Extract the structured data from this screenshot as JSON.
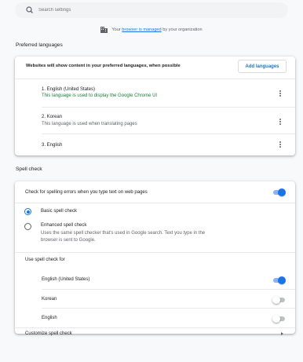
{
  "search": {
    "placeholder": "Search settings"
  },
  "managed": {
    "prefix": "Your",
    "link": "browser is managed",
    "suffix": "by your organization"
  },
  "languages": {
    "section_title": "Preferred languages",
    "header": "Websites will show content in your preferred languages, when possible",
    "add_button": "Add languages",
    "items": [
      {
        "name": "1. English (United States)",
        "note": "This language is used to display the Google Chrome UI"
      },
      {
        "name": "2. Korean",
        "note": "This language is used when translating pages"
      },
      {
        "name": "3. English",
        "note": ""
      }
    ]
  },
  "spell": {
    "section_title": "Spell check",
    "check_label": "Check for spelling errors when you type text on web pages",
    "check_enabled": true,
    "basic_label": "Basic spell check",
    "basic_selected": true,
    "enhanced_label": "Enhanced spell check",
    "enhanced_desc_1": "Uses the same spell checker that's used in Google search. Text you type in the",
    "enhanced_desc_2": "browser is sent to Google.",
    "enhanced_selected": false,
    "use_for_label": "Use spell check for",
    "use_for": [
      {
        "name": "English (United States)",
        "enabled": true
      },
      {
        "name": "Korean",
        "enabled": false
      },
      {
        "name": "English",
        "enabled": false
      }
    ],
    "customize_label": "Customize spell check"
  },
  "colors": {
    "accent": "#1a73e8",
    "green_note": "#188038"
  },
  "icons": {
    "search": "search-icon",
    "managed": "building-icon",
    "more": "more-vert-icon",
    "arrow": "arrow-right-icon"
  }
}
